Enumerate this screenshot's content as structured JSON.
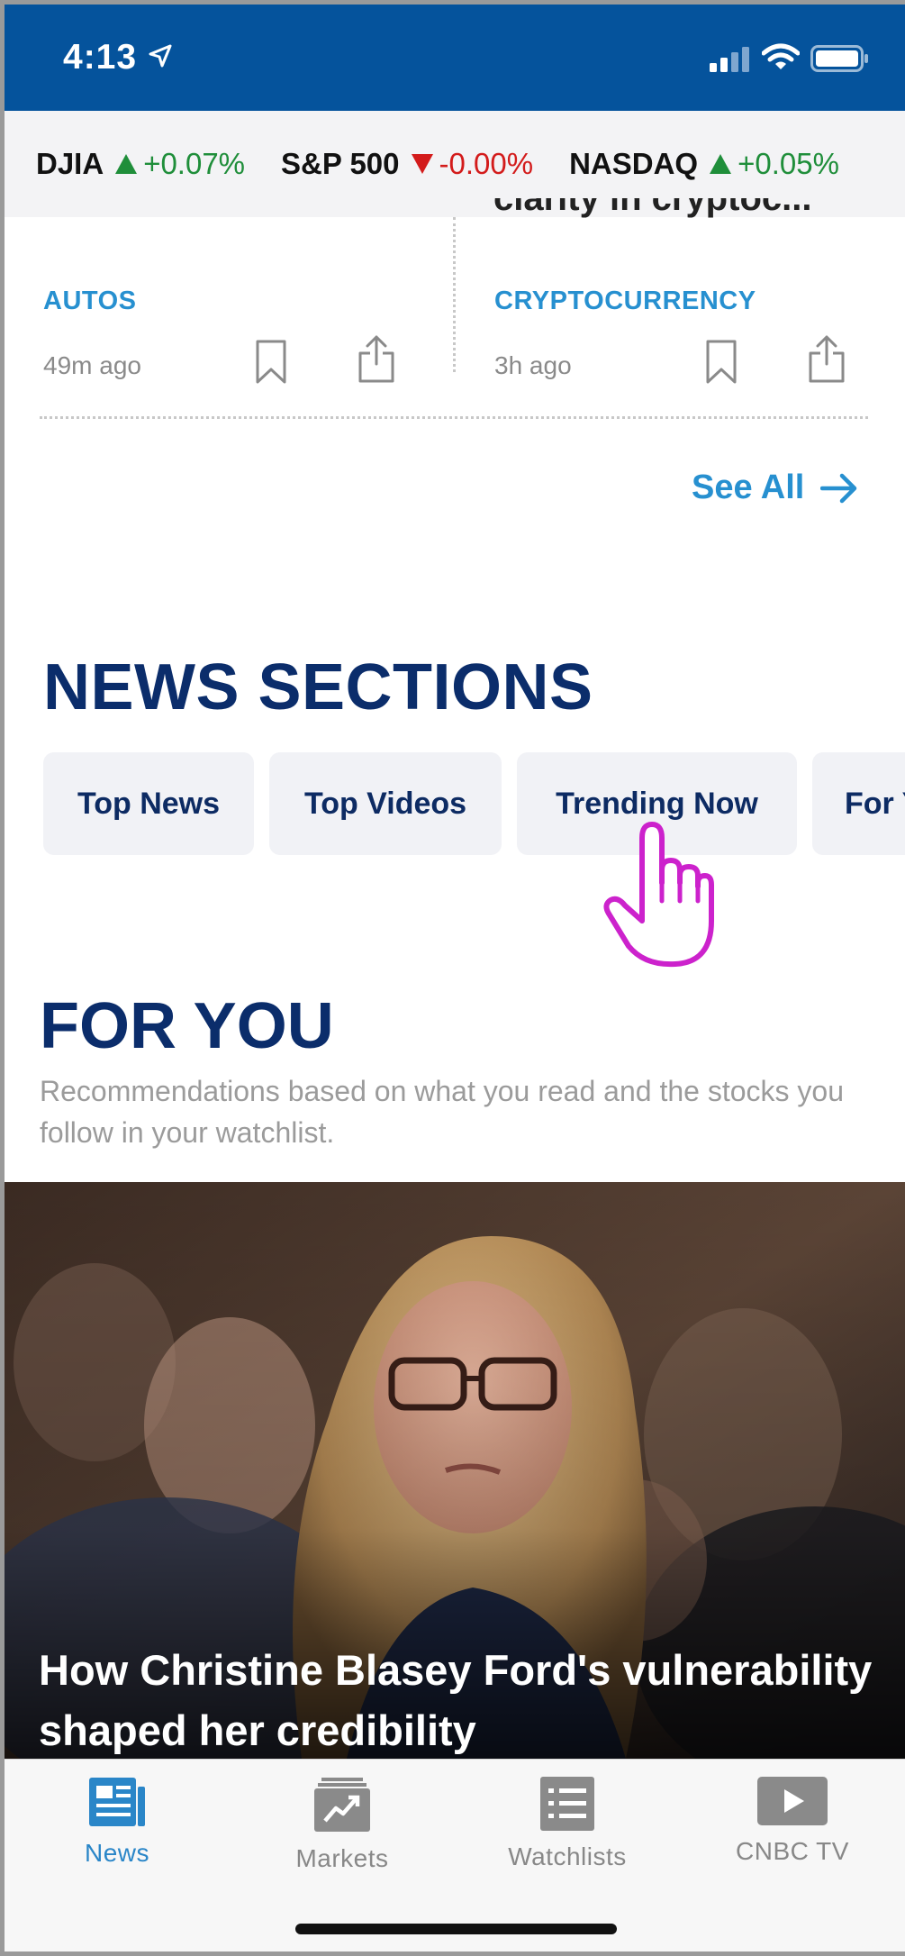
{
  "status_bar": {
    "time": "4:13"
  },
  "ticker": [
    {
      "name": "DJIA",
      "direction": "up",
      "change": "+0.07%"
    },
    {
      "name": "S&P 500",
      "direction": "down",
      "change": "-0.00%"
    },
    {
      "name": "NASDAQ",
      "direction": "up",
      "change": "+0.05%"
    }
  ],
  "articles_row": {
    "clipped_headline": "clarity in cryptoc...",
    "left": {
      "category": "AUTOS",
      "time_ago": "49m ago"
    },
    "right": {
      "category": "CRYPTOCURRENCY",
      "time_ago": "3h ago"
    }
  },
  "see_all": {
    "label": "See All"
  },
  "news_sections": {
    "title": "NEWS SECTIONS",
    "chips": [
      "Top News",
      "Top Videos",
      "Trending Now",
      "For Y"
    ]
  },
  "for_you": {
    "title": "FOR YOU",
    "description": "Recommendations based on what you read and the stocks you follow in your watchlist."
  },
  "hero": {
    "headline": "How Christine Blasey Ford's vulnerability shaped her credibility"
  },
  "tab_bar": {
    "tabs": [
      {
        "label": "News",
        "icon": "newspaper-icon",
        "active": true
      },
      {
        "label": "Markets",
        "icon": "chart-icon",
        "active": false
      },
      {
        "label": "Watchlists",
        "icon": "list-icon",
        "active": false
      },
      {
        "label": "CNBC TV",
        "icon": "play-icon",
        "active": false
      }
    ]
  },
  "colors": {
    "status_blue": "#05539c",
    "accent_blue": "#2790d0",
    "navy": "#0b2d6b",
    "up_green": "#1f8e3a",
    "down_red": "#d31b1b",
    "pointer_magenta": "#cc22cc"
  }
}
